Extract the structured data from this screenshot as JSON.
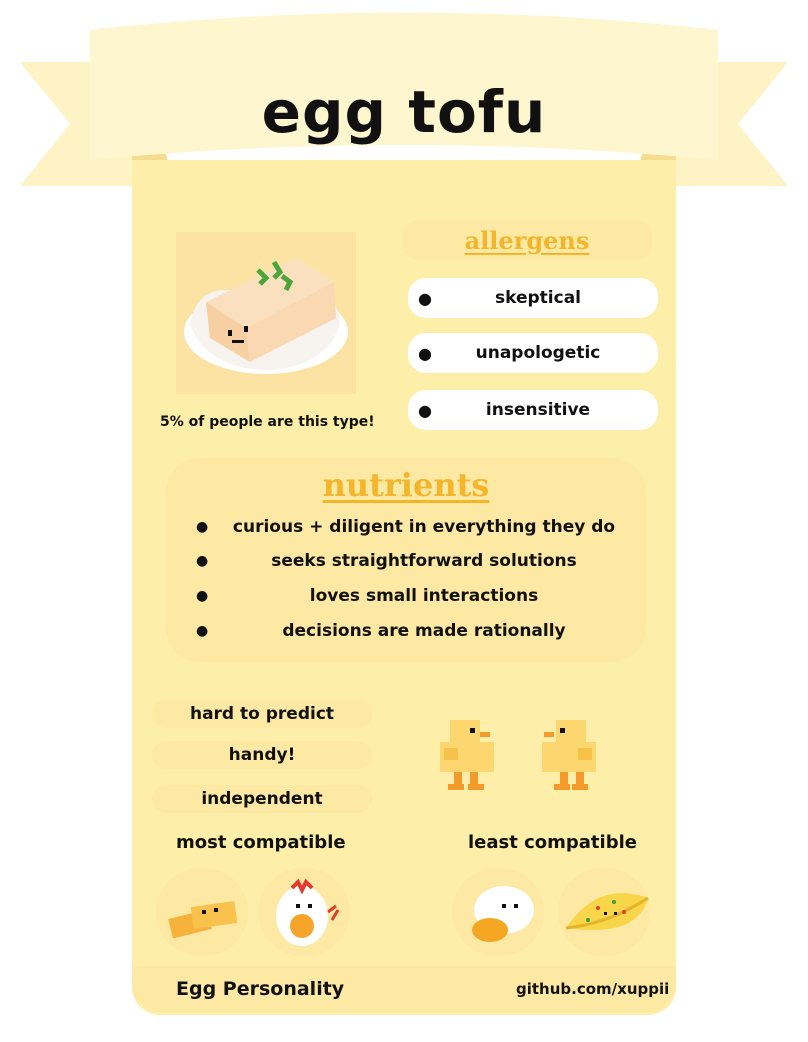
{
  "title": "egg tofu",
  "percent_text": "5%  of people are this type!",
  "allergens": {
    "heading": "allergens",
    "items": [
      "skeptical",
      "unapologetic",
      "insensitive"
    ]
  },
  "nutrients": {
    "heading": "nutrients",
    "items": [
      "curious + diligent in everything they do",
      "seeks straightforward solutions",
      "loves small interactions",
      "decisions are made rationally"
    ]
  },
  "traits": [
    "hard to predict",
    "handy!",
    "independent"
  ],
  "compatibility": {
    "most_label": "most compatible",
    "least_label": "least compatible"
  },
  "footer": {
    "left": "Egg Personality",
    "right": "github.com/xuppii"
  },
  "colors": {
    "ribbon": "#fdf3c4",
    "card": "#fdeea9",
    "panel": "#fde9a4",
    "accent": "#f4b52b"
  }
}
